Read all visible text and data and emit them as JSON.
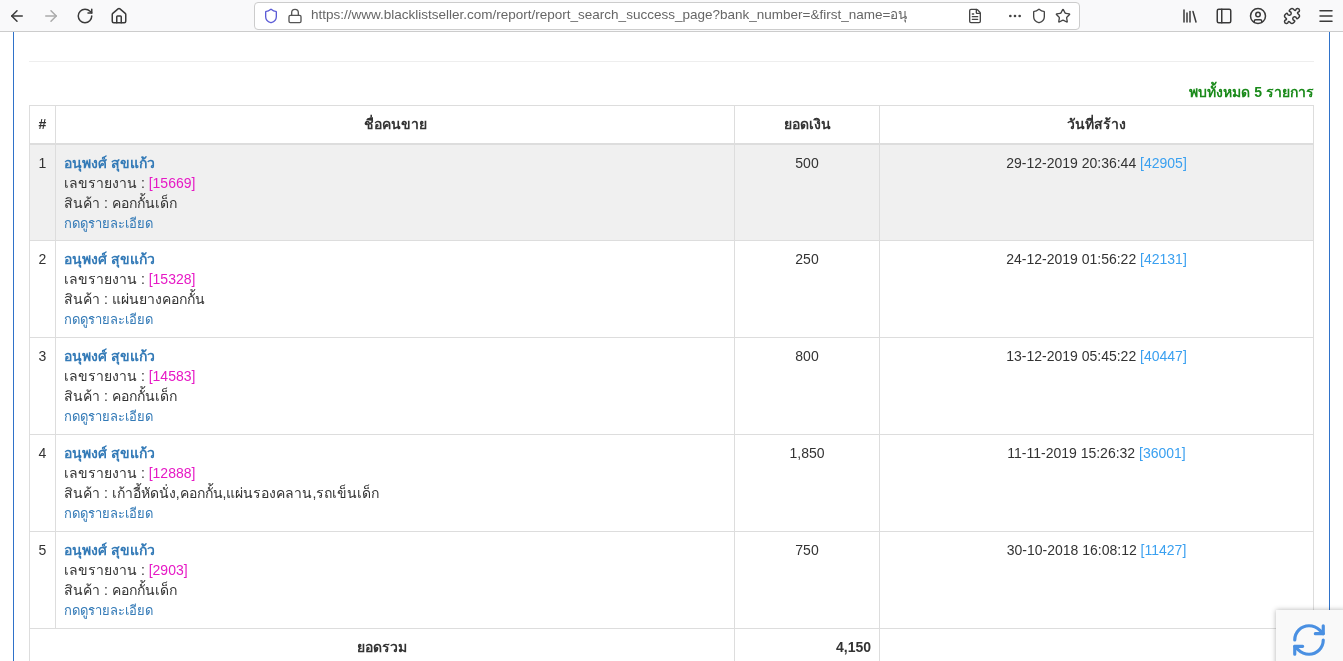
{
  "browser": {
    "url": "https://www.blacklistseller.com/report/report_search_success_page?bank_number=&first_name=อนุ"
  },
  "result_count": {
    "prefix": "พบทั้งหมด",
    "count": "5",
    "suffix": "รายการ"
  },
  "table": {
    "columns": [
      "#",
      "ชื่อคนขาย",
      "ยอดเงิน",
      "วันที่สร้าง"
    ],
    "rows": [
      {
        "no": "1",
        "name": "อนุพงศ์ สุขแก้ว",
        "report_label": "เลขรายงาน :",
        "report_id": "[15669]",
        "product": "สินค้า : คอกกั้นเด็ก",
        "detail_link": "กดดูรายละเอียด",
        "amount": "500",
        "created": "29-12-2019 20:36:44",
        "created_id": "[42905]",
        "highlighted": true
      },
      {
        "no": "2",
        "name": "อนุพงศ์ สุขแก้ว",
        "report_label": "เลขรายงาน :",
        "report_id": "[15328]",
        "product": "สินค้า : แผ่นยางคอกกั้น",
        "detail_link": "กดดูรายละเอียด",
        "amount": "250",
        "created": "24-12-2019 01:56:22",
        "created_id": "[42131]",
        "highlighted": false
      },
      {
        "no": "3",
        "name": "อนุพงศ์ สุขแก้ว",
        "report_label": "เลขรายงาน :",
        "report_id": "[14583]",
        "product": "สินค้า : คอกกั้นเด็ก",
        "detail_link": "กดดูรายละเอียด",
        "amount": "800",
        "created": "13-12-2019 05:45:22",
        "created_id": "[40447]",
        "highlighted": false
      },
      {
        "no": "4",
        "name": "อนุพงศ์ สุขแก้ว",
        "report_label": "เลขรายงาน :",
        "report_id": "[12888]",
        "product": "สินค้า : เก้าอี้หัดนั่ง,คอกกั้น,แผ่นรองคลาน,รถเข็นเด็ก",
        "detail_link": "กดดูรายละเอียด",
        "amount": "1,850",
        "created": "11-11-2019 15:26:32",
        "created_id": "[36001]",
        "highlighted": false
      },
      {
        "no": "5",
        "name": "อนุพงศ์ สุขแก้ว",
        "report_label": "เลขรายงาน :",
        "report_id": "[2903]",
        "product": "สินค้า : คอกกั้นเด็ก",
        "detail_link": "กดดูรายละเอียด",
        "amount": "750",
        "created": "30-10-2018 16:08:12",
        "created_id": "[11427]",
        "highlighted": false
      }
    ],
    "total": {
      "label": "ยอดรวม",
      "amount": "4,150"
    }
  }
}
